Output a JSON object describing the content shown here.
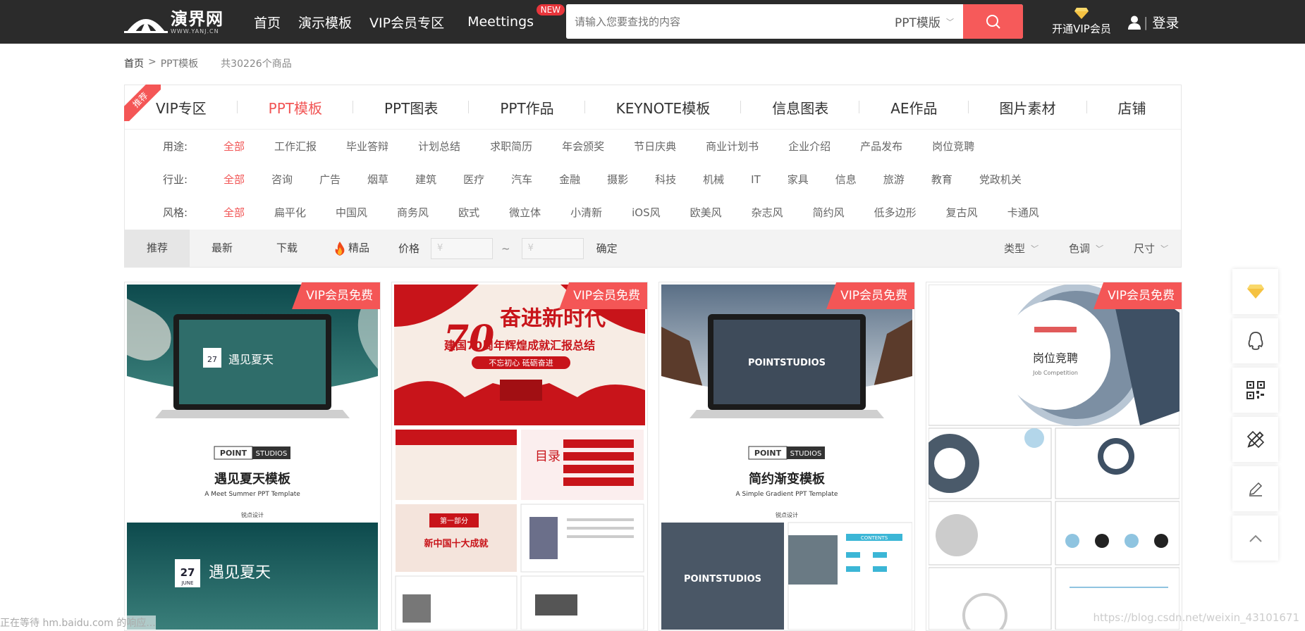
{
  "header": {
    "logo_text": "演界网",
    "logo_url": "WWW.YANJ.CN",
    "nav": [
      "首页",
      "演示模板",
      "VIP会员专区",
      "Meettings"
    ],
    "new_badge": "NEW",
    "search_placeholder": "请输入您要查找的内容",
    "search_type": "PPT模版",
    "vip_open": "开通VIP会员",
    "login": "登录"
  },
  "breadcrumb": {
    "home": "首页",
    "sep": ">",
    "current": "PPT模板",
    "count": "共30226个商品"
  },
  "ribbon": "推荐",
  "categories": [
    {
      "label": "VIP专区"
    },
    {
      "label": "PPT模板"
    },
    {
      "label": "PPT图表"
    },
    {
      "label": "PPT作品"
    },
    {
      "label": "KEYNOTE模板"
    },
    {
      "label": "信息图表"
    },
    {
      "label": "AE作品"
    },
    {
      "label": "图片素材"
    },
    {
      "label": "店铺"
    }
  ],
  "filters": {
    "usage": {
      "label": "用途:",
      "options": [
        "全部",
        "工作汇报",
        "毕业答辩",
        "计划总结",
        "求职简历",
        "年会颁奖",
        "节日庆典",
        "商业计划书",
        "企业介绍",
        "产品发布",
        "岗位竞聘"
      ]
    },
    "industry": {
      "label": "行业:",
      "options": [
        "全部",
        "咨询",
        "广告",
        "烟草",
        "建筑",
        "医疗",
        "汽车",
        "金融",
        "摄影",
        "科技",
        "机械",
        "IT",
        "家具",
        "信息",
        "旅游",
        "教育",
        "党政机关"
      ]
    },
    "style": {
      "label": "风格:",
      "options": [
        "全部",
        "扁平化",
        "中国风",
        "商务风",
        "欧式",
        "微立体",
        "小清新",
        "iOS风",
        "欧美风",
        "杂志风",
        "简约风",
        "低多边形",
        "复古风",
        "卡通风"
      ]
    }
  },
  "sortbar": {
    "recommend": "推荐",
    "latest": "最新",
    "download": "下载",
    "featured": "精品",
    "price_label": "价格",
    "price_min": "¥",
    "price_max": "¥",
    "tilde": "~",
    "confirm": "确定",
    "type": "类型",
    "color": "色调",
    "size": "尺寸"
  },
  "cards": [
    {
      "tag": "VIP会员免费",
      "title": "遇见夏天模板",
      "subtitle": "A Meet Summer PPT Template",
      "brand_left": "POINT",
      "brand_right": "STUDIOS",
      "author": "锐点设计",
      "date": "27",
      "month": "JUNE",
      "slide_title": "遇见夏天"
    },
    {
      "tag": "VIP会员免费",
      "title": "奋进新时代",
      "big_number": "70",
      "headline": "建国70周年辉煌成就汇报总结",
      "slogan": "不忘初心 砥砺奋进",
      "section": "第一部分",
      "section_title": "新中国十大成就",
      "toc": "目录"
    },
    {
      "tag": "VIP会员免费",
      "title": "简约渐变模板",
      "subtitle": "A Simple Gradient PPT Template",
      "brand_left": "POINT",
      "brand_right": "STUDIOS",
      "screen_text": "POINTSTUDIOS",
      "author": "锐点设计",
      "contents": "CONTENTS"
    },
    {
      "tag": "VIP会员免费",
      "title": "岗位竞聘",
      "subtitle": "Job Competition"
    }
  ],
  "status_text": "正在等待 hm.baidu.com 的响应...",
  "watermark": "https://blog.csdn.net/weixin_43101671",
  "colors": {
    "accent": "#f45656",
    "header_bg": "#2b2b2b",
    "active": "#f15555"
  }
}
